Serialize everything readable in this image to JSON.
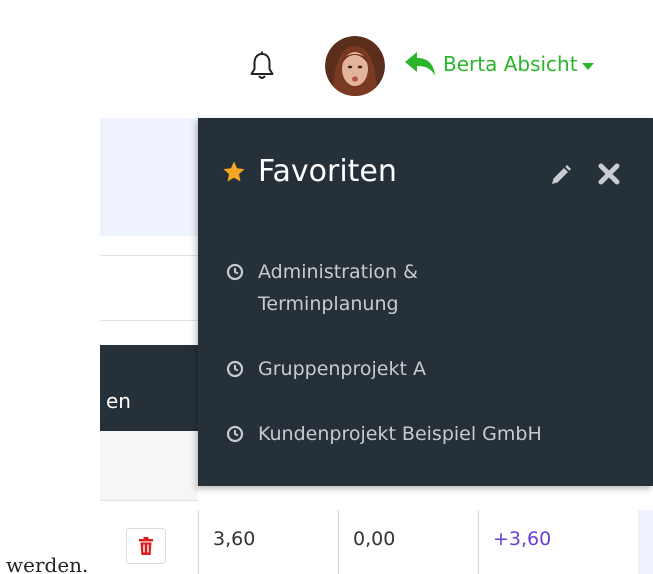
{
  "header": {
    "user_name": "Berta Absicht",
    "icons": {
      "bell": "bell-icon",
      "back": "reply-arrow-icon",
      "caret": "caret-down-icon",
      "avatar": "user-avatar"
    }
  },
  "colors": {
    "accent_green": "#2bb52b",
    "panel_bg": "#263038",
    "star": "#f5a623",
    "trash": "#e01b1b",
    "positive_value": "#6b3fd6"
  },
  "favorites": {
    "title": "Favoriten",
    "icons": {
      "star": "star-icon",
      "edit": "pencil-icon",
      "close": "close-icon",
      "item": "clock-icon"
    },
    "items": [
      {
        "label": "Administration & Terminplanung"
      },
      {
        "label": "Gruppenprojekt A"
      },
      {
        "label": "Kundenprojekt Beispiel GmbH"
      }
    ]
  },
  "background": {
    "column_header_fragment": "en",
    "body_text_fragment": "werden.",
    "row": {
      "values": [
        "3,60",
        "0,00",
        "+3,60"
      ]
    }
  }
}
